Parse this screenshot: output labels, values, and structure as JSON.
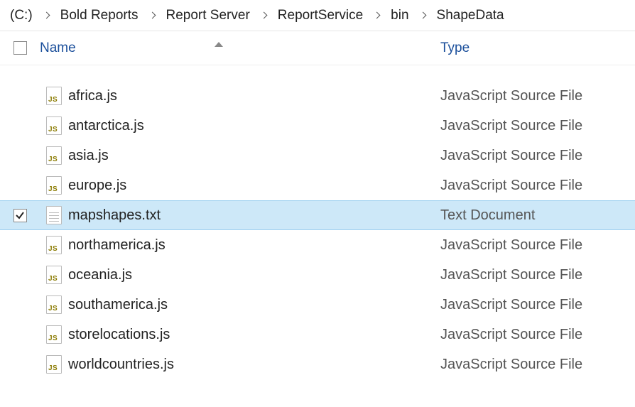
{
  "breadcrumb": [
    {
      "label": "(C:)"
    },
    {
      "label": "Bold Reports"
    },
    {
      "label": "Report Server"
    },
    {
      "label": "ReportService"
    },
    {
      "label": "bin"
    },
    {
      "label": "ShapeData"
    }
  ],
  "columns": {
    "name": "Name",
    "type": "Type"
  },
  "files": [
    {
      "name": "africa.js",
      "type": "JavaScript Source File",
      "icon": "js",
      "selected": false
    },
    {
      "name": "antarctica.js",
      "type": "JavaScript Source File",
      "icon": "js",
      "selected": false
    },
    {
      "name": "asia.js",
      "type": "JavaScript Source File",
      "icon": "js",
      "selected": false
    },
    {
      "name": "europe.js",
      "type": "JavaScript Source File",
      "icon": "js",
      "selected": false
    },
    {
      "name": "mapshapes.txt",
      "type": "Text Document",
      "icon": "txt",
      "selected": true
    },
    {
      "name": "northamerica.js",
      "type": "JavaScript Source File",
      "icon": "js",
      "selected": false
    },
    {
      "name": "oceania.js",
      "type": "JavaScript Source File",
      "icon": "js",
      "selected": false
    },
    {
      "name": "southamerica.js",
      "type": "JavaScript Source File",
      "icon": "js",
      "selected": false
    },
    {
      "name": "storelocations.js",
      "type": "JavaScript Source File",
      "icon": "js",
      "selected": false
    },
    {
      "name": "worldcountries.js",
      "type": "JavaScript Source File",
      "icon": "js",
      "selected": false
    }
  ]
}
